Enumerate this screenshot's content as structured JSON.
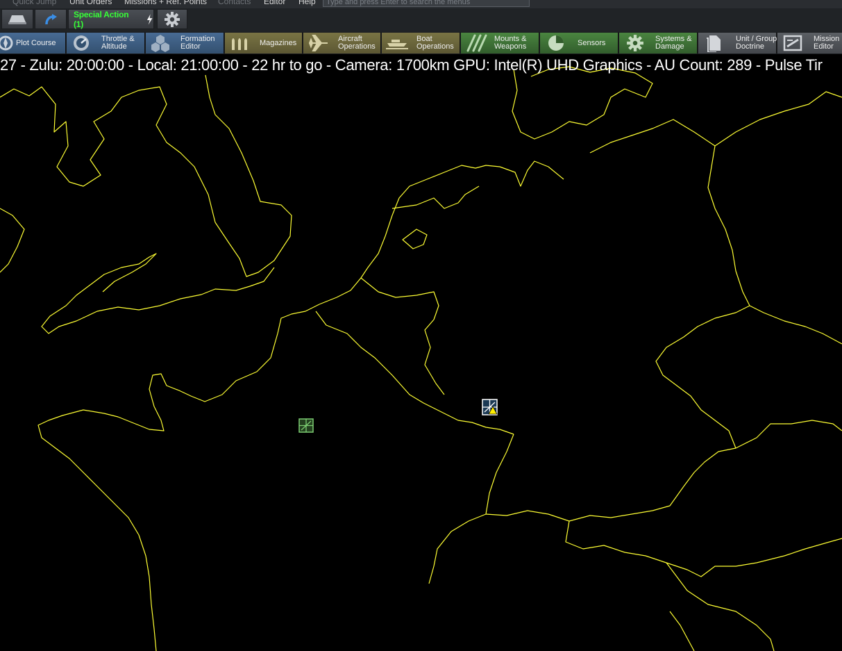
{
  "menu": {
    "items": [
      "Quick Jump",
      "Unit Orders",
      "Missions + Ref. Points",
      "Contacts",
      "Editor",
      "Help"
    ],
    "search_placeholder": "Type and press Enter to search the menus"
  },
  "quickbar": {
    "special_action_label": "Special Action (1)"
  },
  "toolbar": {
    "plot_course": "Plot Course",
    "throttle_1": "Throttle &",
    "throttle_2": "Altitude",
    "formation_1": "Formation",
    "formation_2": "Editor",
    "magazines": "Magazines",
    "aircraft_1": "Aircraft",
    "aircraft_2": "Operations",
    "boat_1": "Boat",
    "boat_2": "Operations",
    "mounts_1": "Mounts &",
    "mounts_2": "Weapons",
    "sensors": "Sensors",
    "systems_1": "Systems &",
    "systems_2": "Damage",
    "doctrine_1": "Unit / Group",
    "doctrine_2": "Doctrine",
    "mission_1": "Mission",
    "mission_2": "Editor"
  },
  "colors": {
    "blue_group": "#3d5f86",
    "olive_group": "#6f6a3c",
    "green_group": "#3f7337",
    "gray_group": "#4f5358",
    "coastline": "#ffff33",
    "special_text": "#37ff37"
  },
  "status": {
    "text": "27 - Zulu: 20:00:00 - Local: 21:00:00 - 22 hr to go - Camera: 1700km GPU: Intel(R) UHD Graphics - AU Count: 289 - Pulse Tir"
  },
  "map": {
    "units": [
      {
        "name": "unit-west",
        "symbol": "airbase-icon"
      },
      {
        "name": "unit-east",
        "symbol": "airbase-icon",
        "alert": "warning-icon"
      }
    ]
  }
}
